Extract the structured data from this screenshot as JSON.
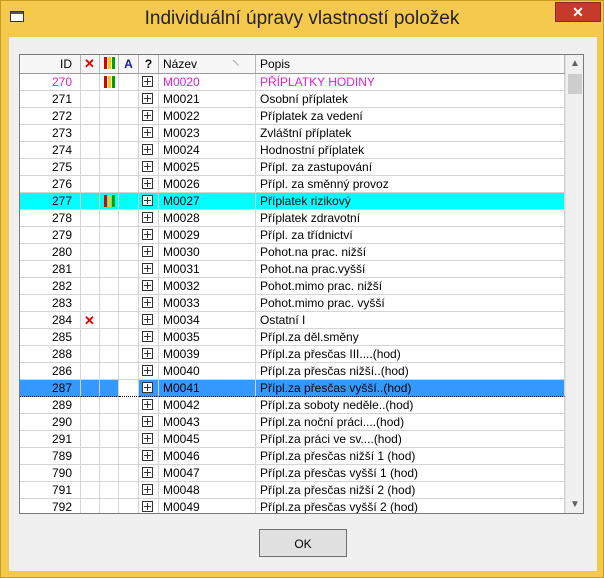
{
  "window": {
    "title": "Individuální úpravy vlastností položek",
    "close_glyph": "✕",
    "accent": "#f4c94e",
    "close_color": "#c7392b"
  },
  "grid": {
    "columns": {
      "id": "ID",
      "flag_x_icon": "x-mark-icon",
      "flag_color_icon": "color-flag-icon",
      "flag_a_label": "A",
      "flag_q_icon": "question-icon",
      "name": "Název",
      "desc": "Popis"
    },
    "highlight_colors": {
      "cyan": "#00ffff",
      "selected": "#3399ff",
      "pink_text": "#e020d0"
    },
    "rows": [
      {
        "id": "270",
        "name": "M0020",
        "desc": "PŘÍPLATKY HODINY",
        "x": false,
        "color": true,
        "style": "pink"
      },
      {
        "id": "271",
        "name": "M0021",
        "desc": "Osobní příplatek",
        "x": false,
        "color": false,
        "style": ""
      },
      {
        "id": "272",
        "name": "M0022",
        "desc": "Příplatek za vedení",
        "x": false,
        "color": false,
        "style": ""
      },
      {
        "id": "273",
        "name": "M0023",
        "desc": "Zvláštní příplatek",
        "x": false,
        "color": false,
        "style": ""
      },
      {
        "id": "274",
        "name": "M0024",
        "desc": "Hodnostní příplatek",
        "x": false,
        "color": false,
        "style": ""
      },
      {
        "id": "275",
        "name": "M0025",
        "desc": "Přípl. za zastupování",
        "x": false,
        "color": false,
        "style": ""
      },
      {
        "id": "276",
        "name": "M0026",
        "desc": "Přípl. za směnný provoz",
        "x": false,
        "color": false,
        "style": ""
      },
      {
        "id": "277",
        "name": "M0027",
        "desc": "Příplatek rizikový",
        "x": false,
        "color": true,
        "style": "cyan"
      },
      {
        "id": "278",
        "name": "M0028",
        "desc": "Příplatek zdravotní",
        "x": false,
        "color": false,
        "style": ""
      },
      {
        "id": "279",
        "name": "M0029",
        "desc": "Přípl. za třídnictví",
        "x": false,
        "color": false,
        "style": ""
      },
      {
        "id": "280",
        "name": "M0030",
        "desc": "Pohot.na prac. nižší",
        "x": false,
        "color": false,
        "style": ""
      },
      {
        "id": "281",
        "name": "M0031",
        "desc": "Pohot.na prac.vyšší",
        "x": false,
        "color": false,
        "style": ""
      },
      {
        "id": "282",
        "name": "M0032",
        "desc": "Pohot.mimo prac. nižší",
        "x": false,
        "color": false,
        "style": ""
      },
      {
        "id": "283",
        "name": "M0033",
        "desc": "Pohot.mimo prac. vyšší",
        "x": false,
        "color": false,
        "style": ""
      },
      {
        "id": "284",
        "name": "M0034",
        "desc": "Ostatní I",
        "x": true,
        "color": false,
        "style": ""
      },
      {
        "id": "285",
        "name": "M0035",
        "desc": "Přípl.za děl.směny",
        "x": false,
        "color": false,
        "style": ""
      },
      {
        "id": "288",
        "name": "M0039",
        "desc": "Přípl.za přesčas III....(hod)",
        "x": false,
        "color": false,
        "style": ""
      },
      {
        "id": "286",
        "name": "M0040",
        "desc": "Přípl.za přesčas nižší..(hod)",
        "x": false,
        "color": false,
        "style": ""
      },
      {
        "id": "287",
        "name": "M0041",
        "desc": "Přípl.za přesčas vyšší..(hod)",
        "x": false,
        "color": false,
        "style": "sel"
      },
      {
        "id": "289",
        "name": "M0042",
        "desc": "Přípl.za soboty neděle..(hod)",
        "x": false,
        "color": false,
        "style": ""
      },
      {
        "id": "290",
        "name": "M0043",
        "desc": "Přípl.za noční práci....(hod)",
        "x": false,
        "color": false,
        "style": ""
      },
      {
        "id": "291",
        "name": "M0045",
        "desc": "Přípl.za práci ve sv....(hod)",
        "x": false,
        "color": false,
        "style": ""
      },
      {
        "id": "789",
        "name": "M0046",
        "desc": "Přípl.za přesčas nižší 1 (hod)",
        "x": false,
        "color": false,
        "style": ""
      },
      {
        "id": "790",
        "name": "M0047",
        "desc": "Přípl.za přesčas vyšší 1 (hod)",
        "x": false,
        "color": false,
        "style": ""
      },
      {
        "id": "791",
        "name": "M0048",
        "desc": "Přípl.za přesčas nižší 2 (hod)",
        "x": false,
        "color": false,
        "style": ""
      },
      {
        "id": "792",
        "name": "M0049",
        "desc": "Přípl.za přesčas vyšší 2 (hod)",
        "x": false,
        "color": false,
        "style": ""
      }
    ]
  },
  "scrollbar": {
    "up_glyph": "▲",
    "down_glyph": "▼"
  },
  "footer": {
    "ok_label": "OK"
  }
}
